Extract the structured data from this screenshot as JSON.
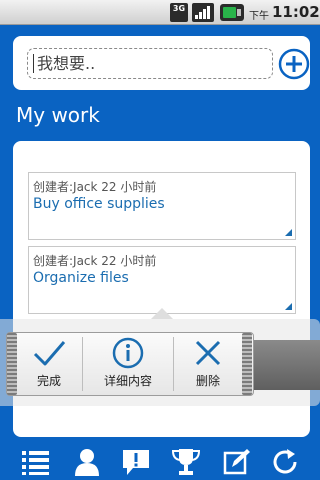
{
  "status_bar": {
    "network": "3G",
    "ampm": "下午",
    "time": "11:02"
  },
  "search": {
    "value": "我想要.."
  },
  "section": {
    "title": "My work"
  },
  "tasks": [
    {
      "meta": "创建者:Jack 22 小时前",
      "title": "Buy office supplies"
    },
    {
      "meta": "创建者:Jack 22 小时前",
      "title": "Organize files"
    }
  ],
  "actions": {
    "complete": "完成",
    "details": "详细内容",
    "delete": "删除"
  },
  "toolbar": {
    "icons": [
      "list-icon",
      "person-icon",
      "alert-icon",
      "trophy-icon",
      "edit-icon",
      "refresh-icon"
    ]
  },
  "colors": {
    "background": "#0a63c2",
    "accent": "#1b6db0",
    "battery": "#29b34a"
  }
}
